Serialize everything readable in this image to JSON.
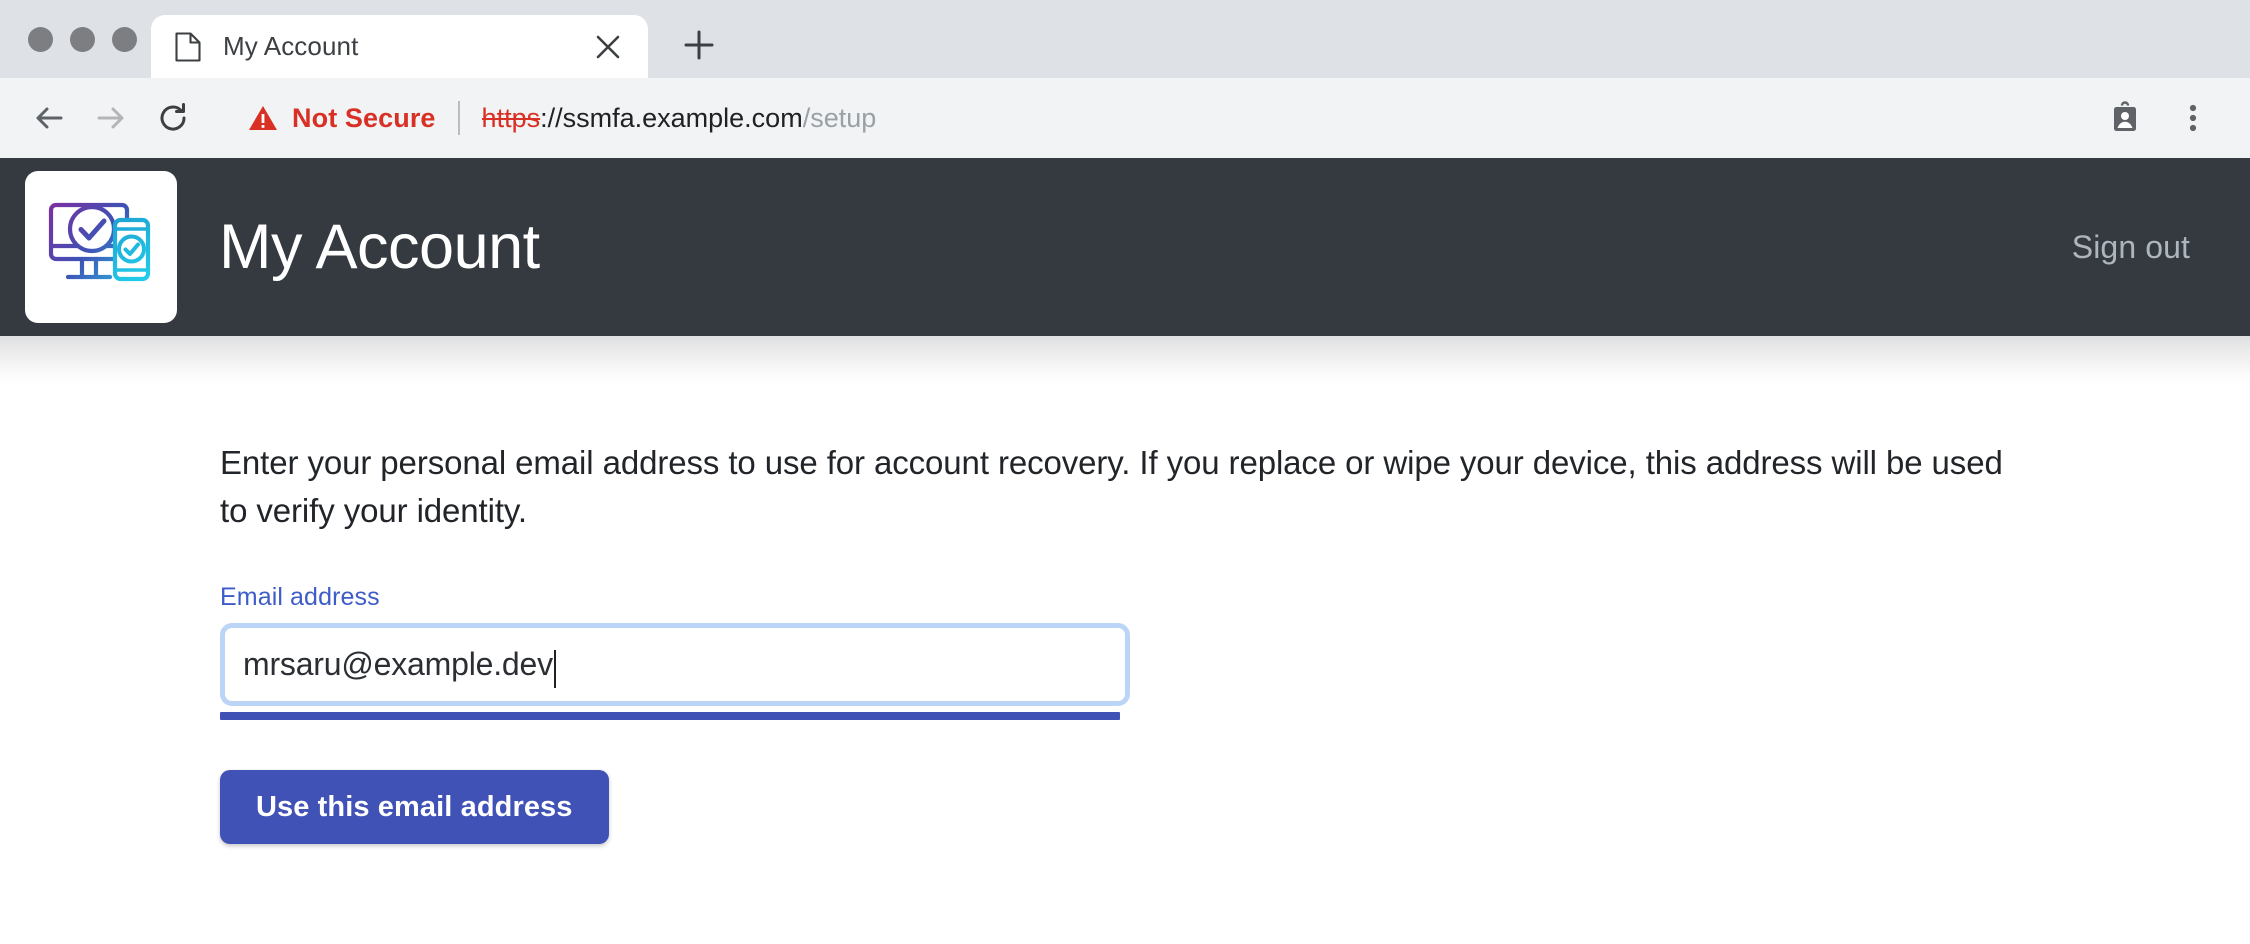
{
  "browser": {
    "traffic_lights": [
      "close-dot",
      "minimize-dot",
      "maximize-dot"
    ],
    "tab": {
      "favicon": "document-icon",
      "title": "My Account",
      "close_label": "✕"
    },
    "new_tab_label": "+",
    "nav": {
      "back": "←",
      "forward": "→",
      "reload": "reload-icon"
    },
    "omnibox": {
      "security_icon": "warning-triangle-icon",
      "security_label": "Not Secure",
      "url_scheme": "https",
      "url_separator": "://",
      "url_host": "ssmfa.example.com",
      "url_path": "/setup"
    },
    "toolbar_icons": [
      {
        "name": "contact-card-icon"
      },
      {
        "name": "browser-menu-icon"
      }
    ]
  },
  "header": {
    "logo_name": "device-verification-logo",
    "title": "My Account",
    "signout_label": "Sign out",
    "background_color": "#343a40"
  },
  "main": {
    "intro_text": "Enter your personal email address to use for account recovery. If you replace or wipe your device, this address will be used to verify your identity.",
    "form": {
      "email_label": "Email address",
      "email_value": "mrsaru@example.dev",
      "email_placeholder": "",
      "submit_label": "Use this email address"
    }
  },
  "colors": {
    "accent": "#4052b5",
    "label_blue": "#3d5cc8",
    "focus_ring": "#bcd4f5",
    "underline": "#3f51b5",
    "danger": "#d93025",
    "header_dark": "#343a40"
  }
}
